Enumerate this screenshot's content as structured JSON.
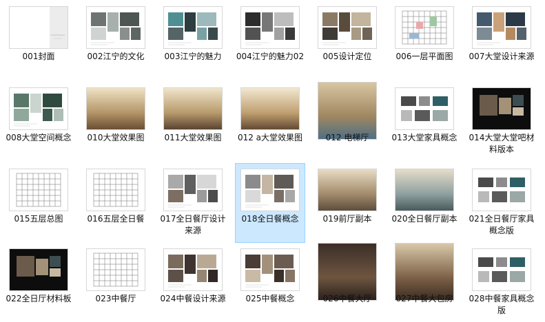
{
  "files": [
    {
      "name": "001封面",
      "thumb": "cover"
    },
    {
      "name": "002江宁的文化",
      "thumb": "collage-light"
    },
    {
      "name": "003江宁的魅力",
      "thumb": "collage-teal"
    },
    {
      "name": "004江宁的魅力02",
      "thumb": "collage-dark"
    },
    {
      "name": "005设计定位",
      "thumb": "collage-interior"
    },
    {
      "name": "006一层平面图",
      "thumb": "plan-color"
    },
    {
      "name": "007大堂设计来源",
      "thumb": "collage-sunset"
    },
    {
      "name": "008大堂空间概念",
      "thumb": "collage-green"
    },
    {
      "name": "010大堂效果图",
      "thumb": "render-lobby"
    },
    {
      "name": "011大堂效果图",
      "thumb": "render-lobby2"
    },
    {
      "name": "012 a大堂效果图",
      "thumb": "render-lobby3"
    },
    {
      "name": "012 电梯厅",
      "thumb": "render-elevator"
    },
    {
      "name": "013大堂家具概念",
      "thumb": "furniture"
    },
    {
      "name": "014大堂大堂吧材料版本",
      "thumb": "material-dark"
    },
    {
      "name": "015五层总图",
      "thumb": "plan-bw"
    },
    {
      "name": "016五层全日餐",
      "thumb": "plan-bw2"
    },
    {
      "name": "017全日餐厅设计来源",
      "thumb": "collage-dining"
    },
    {
      "name": "018全日餐概念",
      "thumb": "collage-concept",
      "selected": true
    },
    {
      "name": "019前厅副本",
      "thumb": "render-foyer"
    },
    {
      "name": "020全日餐厅副本",
      "thumb": "render-dining"
    },
    {
      "name": "021全日餐厅家具概念版",
      "thumb": "furniture2"
    },
    {
      "name": "022全日厅材料板",
      "thumb": "material-dark2"
    },
    {
      "name": "023中餐厅",
      "thumb": "plan-bw3"
    },
    {
      "name": "024中餐设计来源",
      "thumb": "collage-chinese"
    },
    {
      "name": "025中餐概念",
      "thumb": "collage-chinese2"
    },
    {
      "name": "026中餐大厅",
      "thumb": "render-chinese-hall"
    },
    {
      "name": "027中餐大包房",
      "thumb": "render-private-room"
    },
    {
      "name": "028中餐家具概念版",
      "thumb": "furniture3"
    }
  ]
}
